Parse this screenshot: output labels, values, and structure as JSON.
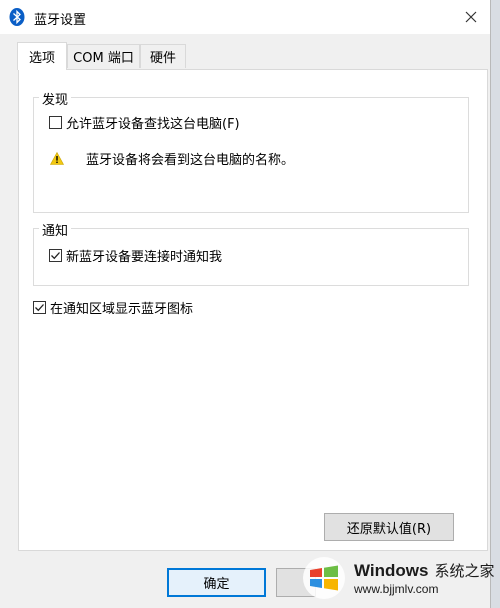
{
  "window": {
    "title": "蓝牙设置",
    "icon": "bluetooth-icon",
    "close_icon": "close-icon"
  },
  "tabs": [
    {
      "label": "选项",
      "active": true
    },
    {
      "label": "COM 端口",
      "active": false
    },
    {
      "label": "硬件",
      "active": false
    }
  ],
  "discovery": {
    "legend": "发现",
    "allow_label": "允许蓝牙设备查找这台电脑(F)",
    "allow_checked": false,
    "warning_icon": "warning-icon",
    "warning_text": "蓝牙设备将会看到这台电脑的名称。"
  },
  "notify": {
    "legend": "通知",
    "new_device_label": "新蓝牙设备要连接时通知我",
    "new_device_checked": true
  },
  "tray": {
    "label": "在通知区域显示蓝牙图标",
    "checked": true
  },
  "buttons": {
    "restore_defaults": "还原默认值(R)",
    "ok": "确定"
  },
  "watermark": {
    "brand": "Windows",
    "brand_cn": "系统之家",
    "url": "www.bjjmlv.com"
  },
  "colors": {
    "accent": "#0078d7",
    "bluetooth": "#0a5ec6",
    "warning": "#f2c811"
  }
}
